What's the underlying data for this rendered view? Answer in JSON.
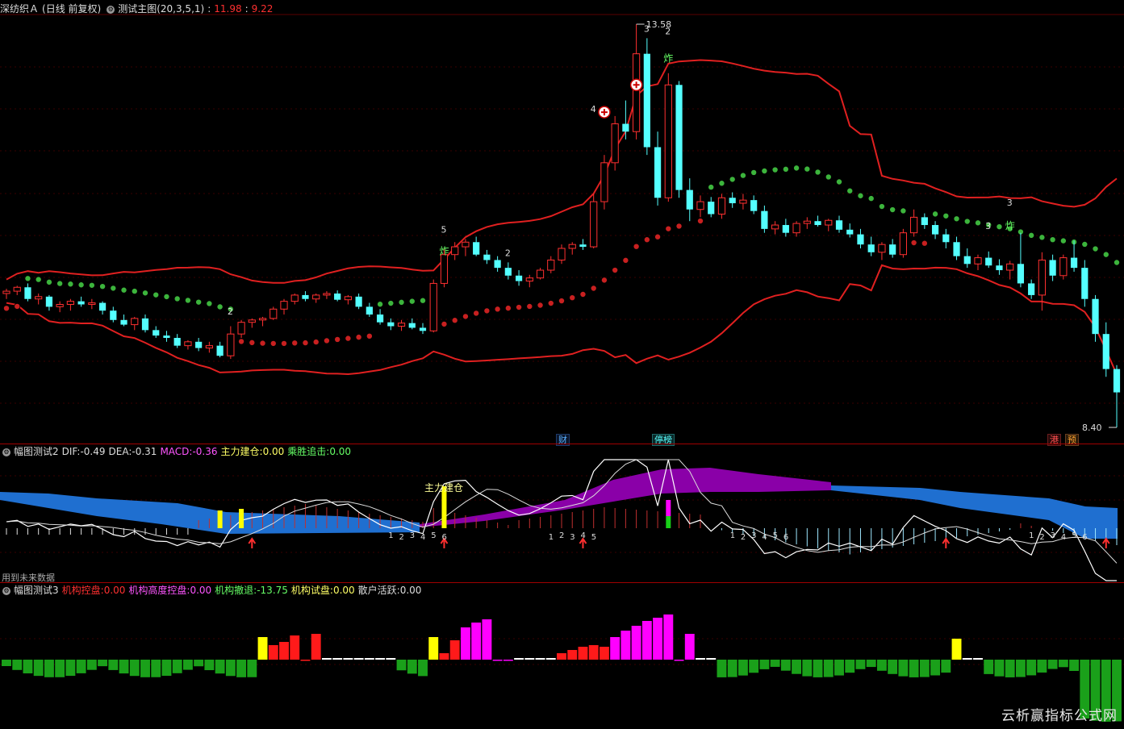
{
  "main_header": {
    "stock": "深纺织Ａ",
    "period": "(日线 前复权)",
    "indicator": "测试主图",
    "params": "(20,3,5,1)",
    "v1": "11.98",
    "v2": "9.22"
  },
  "main_labels": {
    "high": "13.58",
    "low": "8.40",
    "boom": "炸",
    "tags": [
      "财",
      "停榜",
      "港",
      "预"
    ]
  },
  "macd_header": {
    "name": "幅图测试2",
    "dif_label": "DIF:",
    "dif": "-0.49",
    "dea_label": "DEA:",
    "dea": "-0.31",
    "macd_label": "MACD:",
    "macd": "-0.36",
    "zl_label": "主力建仓:",
    "zl": "0.00",
    "cs_label": "乘胜追击:",
    "cs": "0.00",
    "anno": "主力建仓",
    "future": "用到未来数据"
  },
  "inst_header": {
    "name": "幅图测试3",
    "a_label": "机构控盘:",
    "a": "0.00",
    "b_label": "机构高度控盘:",
    "b": "0.00",
    "c_label": "机构撤退:",
    "c": "-13.75",
    "d_label": "机构试盘:",
    "d": "0.00",
    "e_label": "散户活跃:",
    "e": "0.00"
  },
  "watermark": "云析赢指标公式网",
  "colors": {
    "up": "#ff3030",
    "down": "#54ffff",
    "boll": "#e02020",
    "dot_green": "#3cb43c",
    "dot_red": "#c82020",
    "magenta": "#ff00ff",
    "yellow": "#ffff00",
    "green_bar": "#1aa01a",
    "blue_cloud": "#1f6fd0",
    "purple_cloud": "#8a00a8"
  },
  "chart_data": {
    "type": "candlestick",
    "y_range": [
      8.4,
      13.58
    ],
    "candles": [
      [
        10.12,
        10.18,
        10.05,
        10.15
      ],
      [
        10.15,
        10.22,
        10.1,
        10.2
      ],
      [
        10.2,
        10.25,
        10.02,
        10.05
      ],
      [
        10.05,
        10.12,
        9.98,
        10.08
      ],
      [
        10.08,
        10.1,
        9.9,
        9.95
      ],
      [
        9.95,
        10.02,
        9.88,
        9.98
      ],
      [
        9.98,
        10.05,
        9.9,
        10.02
      ],
      [
        10.02,
        10.08,
        9.95,
        9.98
      ],
      [
        9.98,
        10.05,
        9.92,
        10.0
      ],
      [
        10.0,
        10.02,
        9.85,
        9.9
      ],
      [
        9.9,
        9.95,
        9.75,
        9.78
      ],
      [
        9.78,
        9.85,
        9.7,
        9.72
      ],
      [
        9.72,
        9.82,
        9.65,
        9.8
      ],
      [
        9.8,
        9.85,
        9.62,
        9.65
      ],
      [
        9.65,
        9.7,
        9.55,
        9.58
      ],
      [
        9.58,
        9.64,
        9.5,
        9.55
      ],
      [
        9.55,
        9.6,
        9.42,
        9.45
      ],
      [
        9.45,
        9.52,
        9.4,
        9.5
      ],
      [
        9.5,
        9.55,
        9.38,
        9.42
      ],
      [
        9.42,
        9.5,
        9.36,
        9.45
      ],
      [
        9.45,
        9.5,
        9.3,
        9.32
      ],
      [
        9.32,
        9.7,
        9.28,
        9.6
      ],
      [
        9.6,
        9.78,
        9.55,
        9.75
      ],
      [
        9.75,
        9.8,
        9.68,
        9.78
      ],
      [
        9.78,
        9.82,
        9.7,
        9.8
      ],
      [
        9.8,
        9.95,
        9.78,
        9.92
      ],
      [
        9.92,
        10.05,
        9.85,
        10.02
      ],
      [
        10.02,
        10.12,
        9.98,
        10.1
      ],
      [
        10.1,
        10.15,
        10.02,
        10.05
      ],
      [
        10.05,
        10.12,
        10.0,
        10.1
      ],
      [
        10.1,
        10.15,
        10.05,
        10.12
      ],
      [
        10.12,
        10.16,
        10.02,
        10.04
      ],
      [
        10.04,
        10.1,
        9.98,
        10.08
      ],
      [
        10.08,
        10.12,
        9.92,
        9.95
      ],
      [
        9.95,
        10.0,
        9.82,
        9.85
      ],
      [
        9.85,
        9.92,
        9.72,
        9.75
      ],
      [
        9.75,
        9.8,
        9.65,
        9.7
      ],
      [
        9.7,
        9.78,
        9.64,
        9.74
      ],
      [
        9.74,
        9.8,
        9.66,
        9.68
      ],
      [
        9.68,
        9.74,
        9.6,
        9.64
      ],
      [
        9.64,
        10.3,
        9.62,
        10.25
      ],
      [
        10.25,
        10.7,
        10.2,
        10.62
      ],
      [
        10.62,
        10.78,
        10.55,
        10.72
      ],
      [
        10.72,
        10.82,
        10.6,
        10.78
      ],
      [
        10.78,
        10.85,
        10.6,
        10.62
      ],
      [
        10.62,
        10.68,
        10.5,
        10.55
      ],
      [
        10.55,
        10.6,
        10.4,
        10.45
      ],
      [
        10.45,
        10.52,
        10.3,
        10.35
      ],
      [
        10.35,
        10.42,
        10.22,
        10.28
      ],
      [
        10.28,
        10.36,
        10.2,
        10.32
      ],
      [
        10.32,
        10.45,
        10.3,
        10.42
      ],
      [
        10.42,
        10.6,
        10.38,
        10.55
      ],
      [
        10.55,
        10.75,
        10.5,
        10.7
      ],
      [
        10.7,
        10.78,
        10.62,
        10.75
      ],
      [
        10.75,
        10.82,
        10.68,
        10.72
      ],
      [
        10.72,
        11.4,
        10.7,
        11.3
      ],
      [
        11.3,
        11.9,
        11.2,
        11.8
      ],
      [
        11.8,
        12.4,
        11.7,
        12.3
      ],
      [
        12.3,
        12.6,
        12.1,
        12.2
      ],
      [
        12.2,
        13.58,
        12.1,
        13.2
      ],
      [
        13.2,
        13.4,
        11.9,
        12.0
      ],
      [
        12.0,
        12.2,
        11.25,
        11.35
      ],
      [
        11.35,
        12.95,
        11.3,
        12.8
      ],
      [
        12.8,
        12.85,
        11.35,
        11.45
      ],
      [
        11.45,
        11.6,
        11.05,
        11.2
      ],
      [
        11.2,
        11.38,
        11.1,
        11.3
      ],
      [
        11.3,
        11.36,
        11.1,
        11.14
      ],
      [
        11.14,
        11.4,
        11.08,
        11.35
      ],
      [
        11.35,
        11.42,
        11.22,
        11.28
      ],
      [
        11.28,
        11.4,
        11.2,
        11.32
      ],
      [
        11.32,
        11.38,
        11.14,
        11.18
      ],
      [
        11.18,
        11.25,
        10.9,
        10.95
      ],
      [
        10.95,
        11.05,
        10.88,
        11.0
      ],
      [
        11.0,
        11.08,
        10.85,
        10.9
      ],
      [
        10.9,
        11.05,
        10.85,
        11.02
      ],
      [
        11.02,
        11.1,
        10.95,
        11.05
      ],
      [
        11.05,
        11.12,
        10.98,
        11.0
      ],
      [
        11.0,
        11.08,
        10.92,
        11.06
      ],
      [
        11.06,
        11.12,
        10.9,
        10.94
      ],
      [
        10.94,
        11.02,
        10.84,
        10.88
      ],
      [
        10.88,
        10.95,
        10.7,
        10.75
      ],
      [
        10.75,
        10.85,
        10.6,
        10.65
      ],
      [
        10.65,
        10.78,
        10.55,
        10.75
      ],
      [
        10.75,
        10.82,
        10.58,
        10.62
      ],
      [
        10.62,
        10.95,
        10.58,
        10.9
      ],
      [
        10.9,
        11.2,
        10.85,
        11.1
      ],
      [
        11.1,
        11.15,
        10.95,
        11.0
      ],
      [
        11.0,
        11.05,
        10.82,
        10.88
      ],
      [
        10.88,
        10.95,
        10.7,
        10.78
      ],
      [
        10.78,
        10.85,
        10.55,
        10.6
      ],
      [
        10.6,
        10.7,
        10.45,
        10.5
      ],
      [
        10.5,
        10.62,
        10.42,
        10.58
      ],
      [
        10.58,
        10.66,
        10.45,
        10.48
      ],
      [
        10.48,
        10.56,
        10.36,
        10.42
      ],
      [
        10.42,
        10.54,
        10.3,
        10.5
      ],
      [
        10.5,
        10.9,
        10.2,
        10.25
      ],
      [
        10.25,
        10.3,
        10.05,
        10.1
      ],
      [
        10.1,
        10.65,
        9.9,
        10.55
      ],
      [
        10.55,
        10.62,
        10.28,
        10.35
      ],
      [
        10.35,
        10.62,
        10.3,
        10.58
      ],
      [
        10.58,
        10.8,
        10.4,
        10.45
      ],
      [
        10.45,
        10.55,
        9.95,
        10.05
      ],
      [
        10.05,
        10.1,
        9.5,
        9.6
      ],
      [
        9.6,
        9.75,
        9.05,
        9.15
      ],
      [
        9.15,
        9.2,
        8.4,
        8.85
      ]
    ]
  }
}
